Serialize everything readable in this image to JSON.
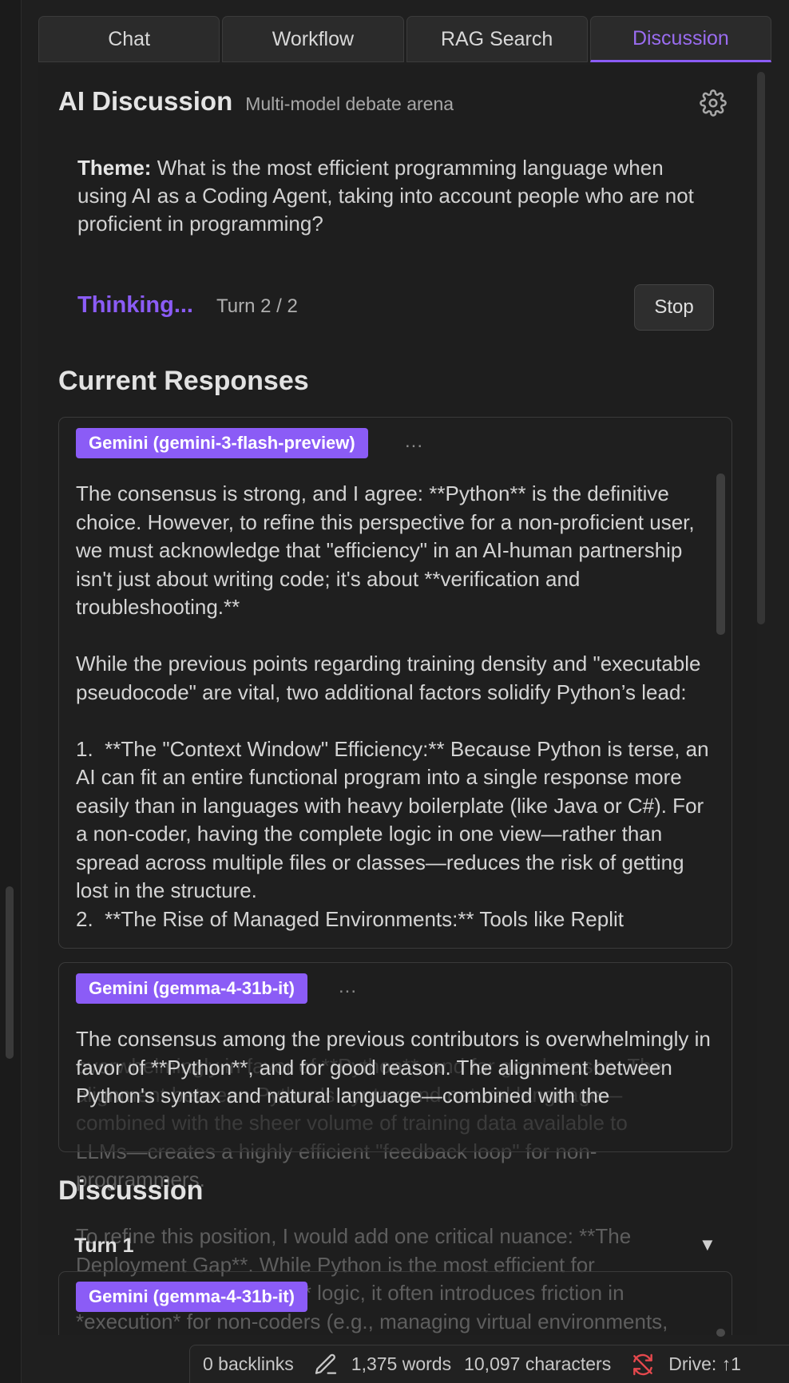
{
  "tabs": [
    "Chat",
    "Workflow",
    "RAG Search",
    "Discussion"
  ],
  "active_tab": "Discussion",
  "header": {
    "title": "AI Discussion",
    "subtitle": "Multi-model debate arena",
    "settings_icon": "gear-icon"
  },
  "theme": {
    "label": "Theme:",
    "text": "What is the most efficient programming language when using AI as a Coding Agent, taking into account people who are not proficient in programming?"
  },
  "status": {
    "thinking": "Thinking...",
    "turn": "Turn 2 / 2",
    "stop_label": "Stop"
  },
  "current_responses": {
    "heading": "Current Responses",
    "cards": [
      {
        "model": "Gemini (gemini-3-flash-preview)",
        "more": "...",
        "text": "The consensus is strong, and I agree: **Python** is the definitive choice. However, to refine this perspective for a non-proficient user, we must acknowledge that \"efficiency\" in an AI-human partnership isn't just about writing code; it's about **verification and troubleshooting.**\n\nWhile the previous points regarding training density and \"executable pseudocode\" are vital, two additional factors solidify Python’s lead:\n\n1.  **The \"Context Window\" Efficiency:** Because Python is terse, an AI can fit an entire functional program into a single response more easily than in languages with heavy boilerplate (like Java or C#). For a non-coder, having the complete logic in one view—rather than spread across multiple files or classes—reduces the risk of getting lost in the structure.\n2.  **The Rise of Managed Environments:** Tools like Replit"
      },
      {
        "model": "Gemini (gemma-4-31b-it)",
        "more": "...",
        "text": "The consensus among the previous contributors is overwhelmingly in favor of **Python**, and for good reason. The alignment between Python's syntax and natural language—combined with the"
      }
    ]
  },
  "ghost_text": "overwhelmingly in favor of **Python**, and for good reason. The\nalignment between Python's syntax and natural language—\ncombined with the sheer volume of training data available to\nLLMs—creates a highly efficient \"feedback loop\" for non-\nprogrammers.\n\nTo refine this position, I would add one critical nuance: **The\nDeployment Gap**. While Python is the most efficient for\n*writing* and *debugging* logic, it often introduces friction in\n*execution* for non-coders (e.g., managing virtual environments,",
  "discussion": {
    "heading": "Discussion",
    "turn_label": "Turn 1",
    "chevron": "▼",
    "first_model": "Gemini (gemma-4-31b-it)"
  },
  "statusbar": {
    "backlinks": "0 backlinks",
    "words": "1,375 words",
    "characters": "10,097 characters",
    "drive": "Drive: ↑1",
    "sync_color": "#e5484d"
  }
}
